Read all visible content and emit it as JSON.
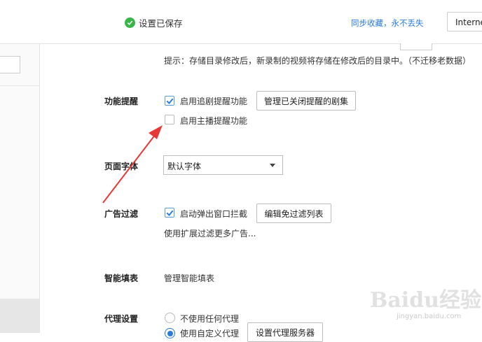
{
  "topbar": {
    "saved_text": "设置已保存",
    "sync_link": "同步收藏，永不丢失",
    "internet_button": "Interne"
  },
  "storage": {
    "hint": "提示：存储目录修改后，新录制的视频将存储在修改后的目录中。（不迁移老数据）"
  },
  "reminder": {
    "label": "功能提醒",
    "option1": "启用追剧提醒功能",
    "option1_checked": true,
    "manage_button": "管理已关闭提醒的剧集",
    "option2": "启用主播提醒功能",
    "option2_checked": false
  },
  "font": {
    "label": "页面字体",
    "selected": "默认字体"
  },
  "adfilter": {
    "label": "广告过滤",
    "option": "启动弹出窗口拦截",
    "option_checked": true,
    "edit_button": "编辑免过滤列表",
    "more_link": "使用扩展过滤更多广告..."
  },
  "autofill": {
    "label": "智能填表",
    "manage_link": "管理智能填表"
  },
  "proxy": {
    "label": "代理设置",
    "option1": "不使用任何代理",
    "option2": "使用自定义代理",
    "selected": "option2",
    "server_button": "设置代理服务器"
  },
  "watermark": {
    "main": "Baidu经验",
    "sub": "jingyan.baidu.com"
  },
  "colors": {
    "accent": "#2a7be0",
    "success": "#39b54a",
    "annotation_arrow": "#e53935"
  }
}
